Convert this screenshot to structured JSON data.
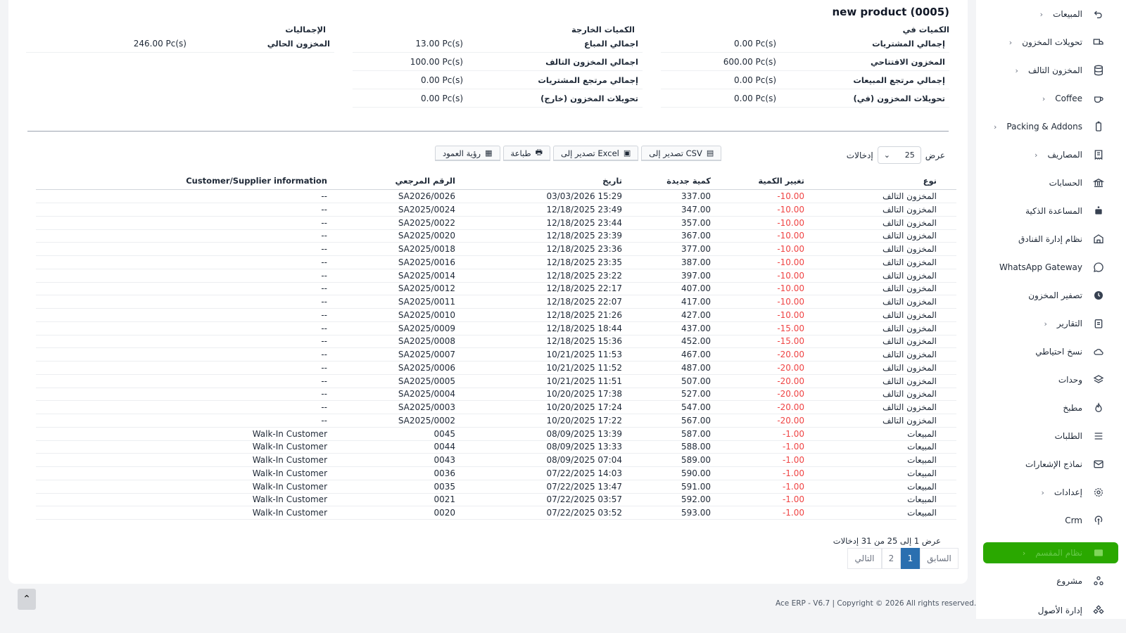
{
  "product_title": "new product (0005)",
  "summary": {
    "in_header": "الكميات في",
    "out_header": "الكميات الخارجة",
    "totals_header": "الإجماليات",
    "in_rows": [
      {
        "label": "إجمالي المشتريات",
        "value": "0.00 Pc(s)"
      },
      {
        "label": "المخزون الافتتاحي",
        "value": "600.00 Pc(s)"
      },
      {
        "label": "إجمالي مرتجع المبيعات",
        "value": "0.00 Pc(s)"
      },
      {
        "label": "تحويلات المخزون (في)",
        "value": "0.00 Pc(s)"
      }
    ],
    "out_rows": [
      {
        "label": "اجمالي المباع",
        "value": "13.00 Pc(s)"
      },
      {
        "label": "اجمالي المخزون التالف",
        "value": "100.00 Pc(s)"
      },
      {
        "label": "إجمالي مرتجع المشتريات",
        "value": "0.00 Pc(s)"
      },
      {
        "label": "تحويلات المخزون (خارج)",
        "value": "0.00 Pc(s)"
      }
    ],
    "total_rows": [
      {
        "label": "المخزون الحالي",
        "value": "246.00 Pc(s)"
      }
    ]
  },
  "controls": {
    "show_label": "عرض",
    "page_len": "25",
    "entries_label": "إدخالات",
    "btn_csv": "تصدير إلى CSV",
    "btn_excel": "تصدير إلى Excel",
    "btn_print": "طباعة",
    "btn_colvis": "رؤية العمود"
  },
  "table": {
    "headers": {
      "type": "نوع",
      "qty_change": "تغيير الكمية",
      "new_qty": "كمية جديدة",
      "date": "تاريخ",
      "ref": "الرقم المرجعي",
      "party": "Customer/Supplier information"
    },
    "rows": [
      {
        "type": "المخزون التالف",
        "qty_change": "-10.00",
        "new_qty": "337.00",
        "date": "03/03/2026 15:29",
        "ref": "SA2026/0026",
        "party": "--"
      },
      {
        "type": "المخزون التالف",
        "qty_change": "-10.00",
        "new_qty": "347.00",
        "date": "12/18/2025 23:49",
        "ref": "SA2025/0024",
        "party": "--"
      },
      {
        "type": "المخزون التالف",
        "qty_change": "-10.00",
        "new_qty": "357.00",
        "date": "12/18/2025 23:44",
        "ref": "SA2025/0022",
        "party": "--"
      },
      {
        "type": "المخزون التالف",
        "qty_change": "-10.00",
        "new_qty": "367.00",
        "date": "12/18/2025 23:39",
        "ref": "SA2025/0020",
        "party": "--"
      },
      {
        "type": "المخزون التالف",
        "qty_change": "-10.00",
        "new_qty": "377.00",
        "date": "12/18/2025 23:36",
        "ref": "SA2025/0018",
        "party": "--"
      },
      {
        "type": "المخزون التالف",
        "qty_change": "-10.00",
        "new_qty": "387.00",
        "date": "12/18/2025 23:35",
        "ref": "SA2025/0016",
        "party": "--"
      },
      {
        "type": "المخزون التالف",
        "qty_change": "-10.00",
        "new_qty": "397.00",
        "date": "12/18/2025 23:22",
        "ref": "SA2025/0014",
        "party": "--"
      },
      {
        "type": "المخزون التالف",
        "qty_change": "-10.00",
        "new_qty": "407.00",
        "date": "12/18/2025 22:17",
        "ref": "SA2025/0012",
        "party": "--"
      },
      {
        "type": "المخزون التالف",
        "qty_change": "-10.00",
        "new_qty": "417.00",
        "date": "12/18/2025 22:07",
        "ref": "SA2025/0011",
        "party": "--"
      },
      {
        "type": "المخزون التالف",
        "qty_change": "-10.00",
        "new_qty": "427.00",
        "date": "12/18/2025 21:26",
        "ref": "SA2025/0010",
        "party": "--"
      },
      {
        "type": "المخزون التالف",
        "qty_change": "-15.00",
        "new_qty": "437.00",
        "date": "12/18/2025 18:44",
        "ref": "SA2025/0009",
        "party": "--"
      },
      {
        "type": "المخزون التالف",
        "qty_change": "-15.00",
        "new_qty": "452.00",
        "date": "12/18/2025 15:36",
        "ref": "SA2025/0008",
        "party": "--"
      },
      {
        "type": "المخزون التالف",
        "qty_change": "-20.00",
        "new_qty": "467.00",
        "date": "10/21/2025 11:53",
        "ref": "SA2025/0007",
        "party": "--"
      },
      {
        "type": "المخزون التالف",
        "qty_change": "-20.00",
        "new_qty": "487.00",
        "date": "10/21/2025 11:52",
        "ref": "SA2025/0006",
        "party": "--"
      },
      {
        "type": "المخزون التالف",
        "qty_change": "-20.00",
        "new_qty": "507.00",
        "date": "10/21/2025 11:51",
        "ref": "SA2025/0005",
        "party": "--"
      },
      {
        "type": "المخزون التالف",
        "qty_change": "-20.00",
        "new_qty": "527.00",
        "date": "10/20/2025 17:38",
        "ref": "SA2025/0004",
        "party": "--"
      },
      {
        "type": "المخزون التالف",
        "qty_change": "-20.00",
        "new_qty": "547.00",
        "date": "10/20/2025 17:24",
        "ref": "SA2025/0003",
        "party": "--"
      },
      {
        "type": "المخزون التالف",
        "qty_change": "-20.00",
        "new_qty": "567.00",
        "date": "10/20/2025 17:22",
        "ref": "SA2025/0002",
        "party": "--"
      },
      {
        "type": "المبيعات",
        "qty_change": "-1.00",
        "new_qty": "587.00",
        "date": "08/09/2025 13:39",
        "ref": "0045",
        "party": "Walk-In Customer"
      },
      {
        "type": "المبيعات",
        "qty_change": "-1.00",
        "new_qty": "588.00",
        "date": "08/09/2025 13:33",
        "ref": "0044",
        "party": "Walk-In Customer"
      },
      {
        "type": "المبيعات",
        "qty_change": "-1.00",
        "new_qty": "589.00",
        "date": "08/09/2025 07:04",
        "ref": "0043",
        "party": "Walk-In Customer"
      },
      {
        "type": "المبيعات",
        "qty_change": "-1.00",
        "new_qty": "590.00",
        "date": "07/22/2025 14:03",
        "ref": "0036",
        "party": "Walk-In Customer"
      },
      {
        "type": "المبيعات",
        "qty_change": "-1.00",
        "new_qty": "591.00",
        "date": "07/22/2025 13:47",
        "ref": "0035",
        "party": "Walk-In Customer"
      },
      {
        "type": "المبيعات",
        "qty_change": "-1.00",
        "new_qty": "592.00",
        "date": "07/22/2025 03:57",
        "ref": "0021",
        "party": "Walk-In Customer"
      },
      {
        "type": "المبيعات",
        "qty_change": "-1.00",
        "new_qty": "593.00",
        "date": "07/22/2025 03:52",
        "ref": "0020",
        "party": "Walk-In Customer"
      }
    ]
  },
  "pagination": {
    "info": "عرض 1 إلى 25 من 31 إدخالات",
    "prev": "السابق",
    "page1": "1",
    "page2": "2",
    "next": "التالي"
  },
  "sidebar": {
    "items": [
      {
        "label": "المبيعات",
        "icon": "undo-icon",
        "chevron": true
      },
      {
        "label": "تحويلات المخزون",
        "icon": "truck-icon",
        "chevron": true
      },
      {
        "label": "المخزون التالف",
        "icon": "database-icon",
        "chevron": true
      },
      {
        "label": "Coffee",
        "icon": "coffee-icon",
        "chevron": true
      },
      {
        "label": "Packing & Addons",
        "icon": "battery-icon",
        "chevron": true
      },
      {
        "label": "المصاريف",
        "icon": "receipt-icon",
        "chevron": true
      },
      {
        "label": "الحسابات",
        "icon": "bank-icon",
        "chevron": false
      },
      {
        "label": "المساعدة الذكية",
        "icon": "robot-icon",
        "chevron": false
      },
      {
        "label": "نظام إدارة الفنادق",
        "icon": "hotel-icon",
        "chevron": false
      },
      {
        "label": "WhatsApp Gateway",
        "icon": "whatsapp-icon",
        "chevron": false
      },
      {
        "label": "تصفير المخزون",
        "icon": "clock-icon",
        "chevron": false
      },
      {
        "label": "التقارير",
        "icon": "report-icon",
        "chevron": true
      },
      {
        "label": "نسخ احتياطي",
        "icon": "cloud-icon",
        "chevron": false
      },
      {
        "label": "وحدات",
        "icon": "layers-icon",
        "chevron": false
      },
      {
        "label": "مطبخ",
        "icon": "fire-icon",
        "chevron": false
      },
      {
        "label": "الطلبات",
        "icon": "list-icon",
        "chevron": false
      },
      {
        "label": "نماذج الإشعارات",
        "icon": "mail-icon",
        "chevron": false
      },
      {
        "label": "إعدادات",
        "icon": "gear-icon",
        "chevron": true
      },
      {
        "label": "Crm",
        "icon": "broadcast-icon",
        "chevron": false
      },
      {
        "label": "نظام المقسم",
        "icon": "grid-icon",
        "chevron": true,
        "active": true
      },
      {
        "label": "مشروع",
        "icon": "project-icon",
        "chevron": false
      },
      {
        "label": "إدارة الأصول",
        "icon": "assets-icon",
        "chevron": false
      }
    ]
  },
  "footer": "Ace ERP - V6.7 | Copyright © 2026 All rights reserved.",
  "colors": {
    "accent": "#2a6fb0",
    "negative": "#ef4444",
    "active_menu": "#2aa800"
  }
}
